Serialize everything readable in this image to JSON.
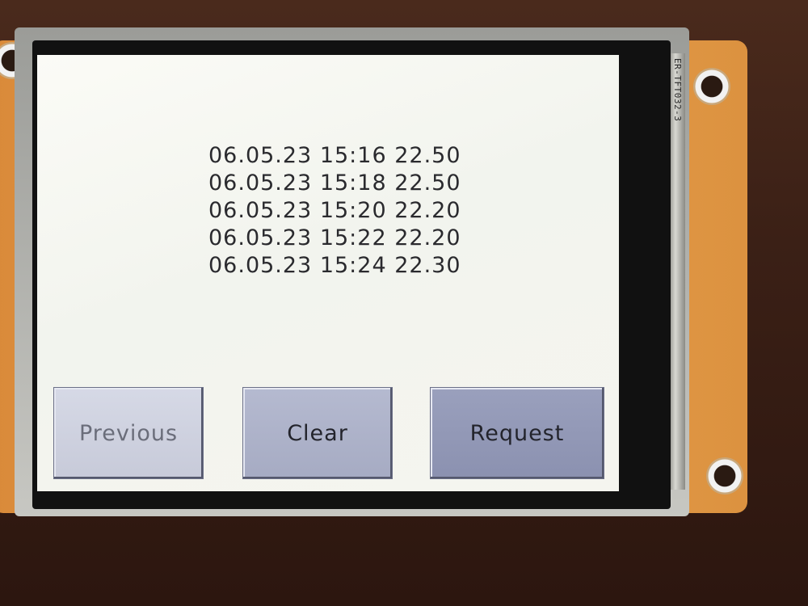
{
  "display": {
    "ribbon_text": "ER-TFT032-3"
  },
  "log": {
    "entries": [
      "06.05.23 15:16 22.50",
      "06.05.23 15:18 22.50",
      "06.05.23 15:20 22.20",
      "06.05.23 15:22 22.20",
      "06.05.23 15:24 22.30"
    ]
  },
  "buttons": {
    "previous_label": "Previous",
    "clear_label": "Clear",
    "request_label": "Request"
  },
  "colors": {
    "screen_background": "#f5f5ef",
    "log_text": "#2a2a2e",
    "button_previous": "#d6d9e6",
    "button_clear": "#b5bad0",
    "button_request": "#9aa0bd",
    "pcb": "#e7a24c"
  },
  "icons": [
    "mount-hole-icon"
  ]
}
